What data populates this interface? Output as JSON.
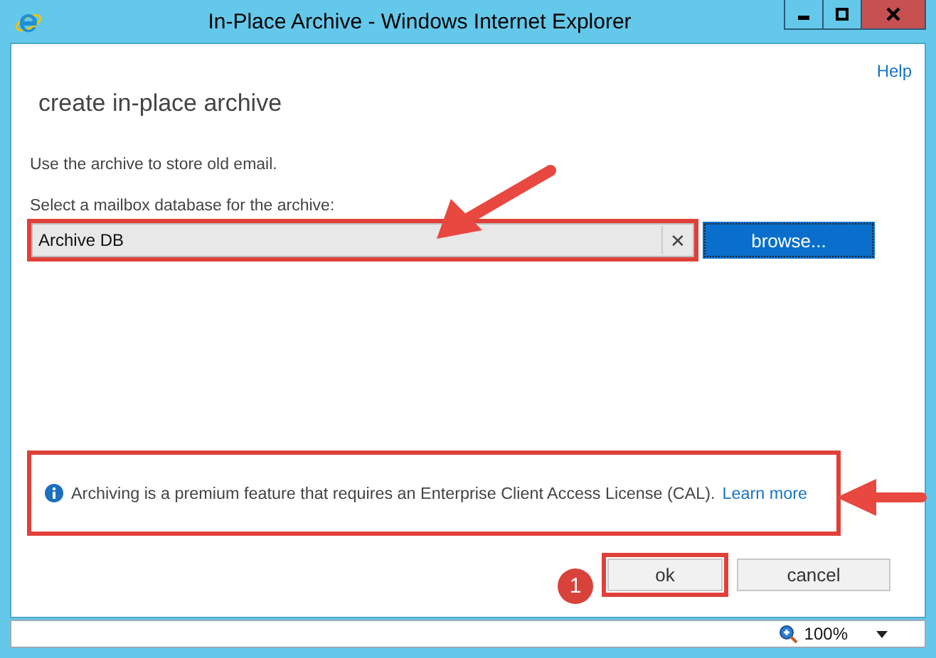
{
  "window": {
    "title": "In-Place Archive - Windows Internet Explorer"
  },
  "help_link": "Help",
  "heading": "create in-place archive",
  "description": "Use the archive to store old email.",
  "database_field": {
    "label": "Select a mailbox database for the archive:",
    "value": "Archive DB",
    "clear_glyph": "✕"
  },
  "browse_button": "browse...",
  "info": {
    "text": "Archiving is a premium feature that requires an Enterprise Client Access License (CAL).",
    "link": "Learn more"
  },
  "buttons": [
    {
      "label": "ok",
      "kind": "primary"
    },
    {
      "label": "cancel",
      "kind": "secondary"
    }
  ],
  "callout_badge": "1",
  "status_bar": {
    "zoom": "100%"
  }
}
